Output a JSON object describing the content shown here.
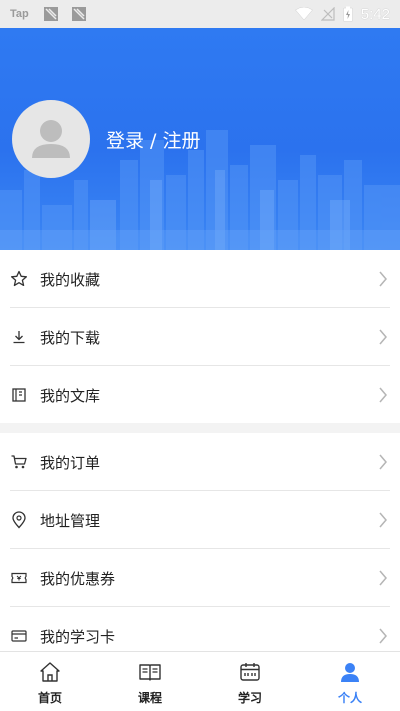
{
  "status_bar": {
    "carrier_label": "Tap",
    "time": "5:42"
  },
  "profile": {
    "login_text": "登录 / 注册"
  },
  "menu_group_1": [
    {
      "label": "我的收藏",
      "icon": "star-icon"
    },
    {
      "label": "我的下载",
      "icon": "download-icon"
    },
    {
      "label": "我的文库",
      "icon": "library-icon"
    }
  ],
  "menu_group_2": [
    {
      "label": "我的订单",
      "icon": "cart-icon"
    },
    {
      "label": "地址管理",
      "icon": "location-pin-icon"
    },
    {
      "label": "我的优惠券",
      "icon": "coupon-icon"
    },
    {
      "label": "我的学习卡",
      "icon": "card-icon"
    }
  ],
  "tabbar": {
    "tabs": [
      {
        "label": "首页",
        "icon": "home-icon",
        "active": false
      },
      {
        "label": "课程",
        "icon": "book-icon",
        "active": false
      },
      {
        "label": "学习",
        "icon": "calendar-icon",
        "active": false
      },
      {
        "label": "个人",
        "icon": "person-icon",
        "active": true
      }
    ],
    "active_color": "#3b82f6"
  },
  "colors": {
    "header_blue": "#2f7af2",
    "accent": "#3b82f6"
  }
}
